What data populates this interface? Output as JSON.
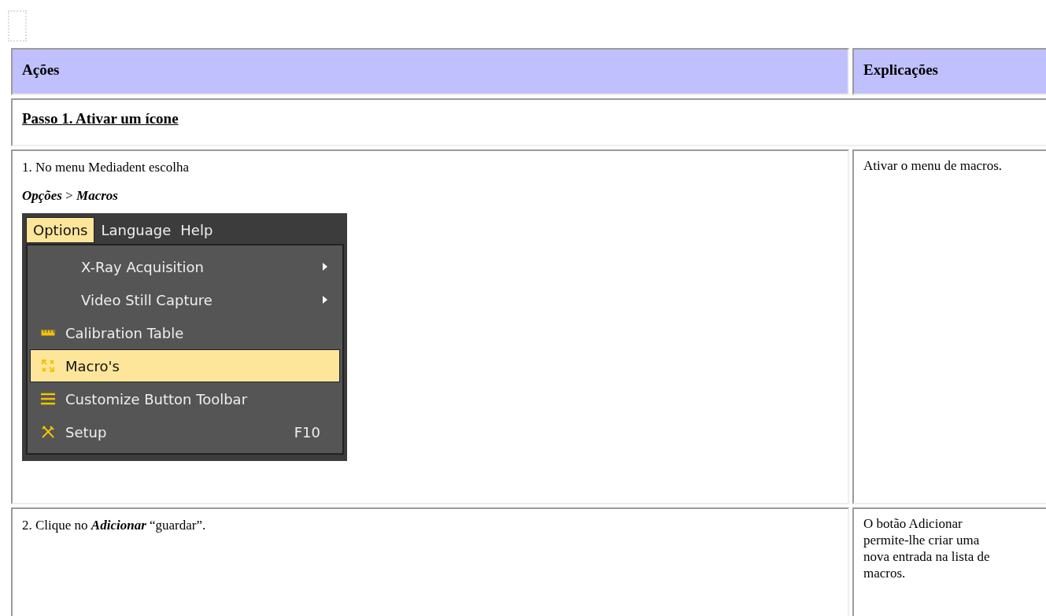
{
  "table": {
    "columns": [
      "Ações",
      "Explicações"
    ],
    "section": "Passo 1. Ativar um ícone",
    "rows": [
      {
        "action_lines": [
          "1. No menu Mediadent escolha",
          "**Opções** > **Macros**"
        ],
        "explanation": "Ativar o menu de macros.",
        "screenshot": {
          "menubar": [
            {
              "label": "Options",
              "selected": true
            },
            {
              "label": "Language",
              "selected": false
            },
            {
              "label": "Help",
              "selected": false
            }
          ],
          "menu": [
            {
              "kind": "submenu",
              "label": "X-Ray Acquisition",
              "selected": false
            },
            {
              "kind": "submenu",
              "label": "Video Still Capture",
              "selected": false
            },
            {
              "kind": "ruler",
              "label": "Calibration Table",
              "selected": false
            },
            {
              "kind": "macro",
              "label": "Macro's",
              "selected": true
            },
            {
              "kind": "lines",
              "label": "Customize Button Toolbar",
              "selected": false
            },
            {
              "kind": "tools",
              "label": "Setup",
              "shortcut": "F10",
              "selected": false
            }
          ]
        }
      },
      {
        "action_lines": [
          "2. Clique no **Adicionar** “guardar”."
        ],
        "explanation": "O botão Adicionar permite-lhe criar uma nova entrada na lista de macros."
      }
    ]
  }
}
